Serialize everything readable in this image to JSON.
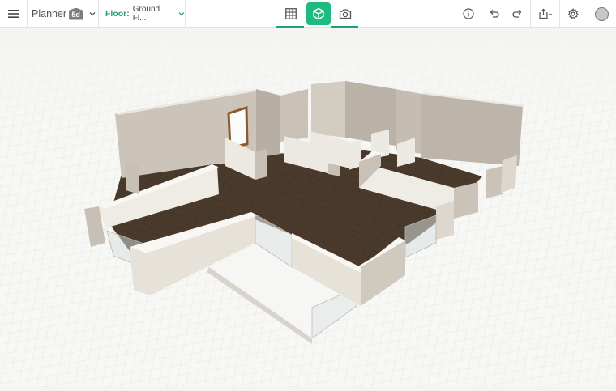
{
  "header": {
    "brand_text": "Planner",
    "brand_logo_text": "5d",
    "floor_label": "Floor:",
    "floor_value": "Ground Fl..."
  },
  "view_modes": {
    "active": "3d",
    "items": [
      "2d-plan-view",
      "3d-view",
      "photo-view"
    ]
  },
  "icons": {
    "menu": "menu-icon",
    "chevron": "chevron-down-icon",
    "grid": "grid-icon",
    "cube": "cube-icon",
    "camera": "camera-icon",
    "info": "info-icon",
    "undo": "undo-icon",
    "redo": "redo-icon",
    "share": "share-icon",
    "settings": "gear-icon",
    "profile": "avatar-icon"
  },
  "colors": {
    "accent": "#1fa36e",
    "active_view_bg": "#1dbb7d",
    "floor_wood": "#4a3a2c",
    "wall_top": "#f1efe9",
    "wall_side": "#cdc6ba",
    "grid_line": "#e2e2e0"
  }
}
